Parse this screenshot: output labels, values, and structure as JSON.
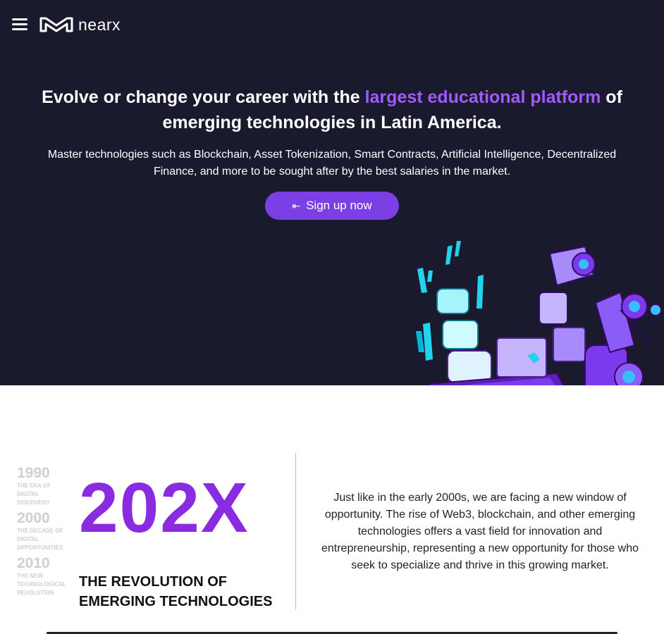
{
  "header": {
    "logo_text": "nearx",
    "menu_icon": "hamburger-menu-icon"
  },
  "hero": {
    "headline_part1": "Evolve or change your career with the ",
    "headline_accent": "largest educational platform",
    "headline_part2": " of emerging technologies in Latin America.",
    "subtext": "Master technologies such as Blockchain, Asset Tokenization, Smart Contracts, Artificial Intelligence, Decentralized Finance, and more to be sought after by the best salaries in the market.",
    "cta_label": "Sign up now",
    "cta_icon": "login-arrow-icon",
    "background_color": "#1a1a2e",
    "accent_color": "#a259ff",
    "button_color": "#7b3fe4"
  },
  "timeline": [
    {
      "year": "1990",
      "desc": "THE ERA OF DIGITAL DISCOVERY"
    },
    {
      "year": "2000",
      "desc": "THE DECADE OF DIGITAL OPPORTUNITIES"
    },
    {
      "year": "2010",
      "desc": "THE NEW TECHNOLOGICAL REVOLUTION"
    }
  ],
  "revolution": {
    "big_title": "202X",
    "subtitle_line1": "THE REVOLUTION OF",
    "subtitle_line2": "EMERGING TECHNOLOGIES",
    "description": "Just like in the early 2000s, we are facing a new window of opportunity. The rise of Web3, blockchain, and other emerging technologies offers a vast field for innovation and entrepreneurship, representing a new opportunity for those who seek to specialize and thrive in this growing market.",
    "accent_color": "#8a2be2"
  }
}
